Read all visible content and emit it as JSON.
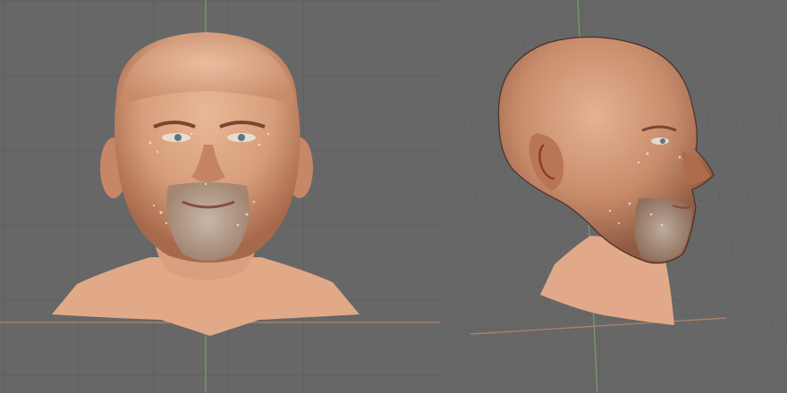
{
  "viewports": [
    {
      "id": "front",
      "view": "front-orthographic",
      "subject": "head-mesh-front"
    },
    {
      "id": "side",
      "view": "side-perspective",
      "subject": "head-mesh-profile"
    }
  ],
  "colors": {
    "background": "#676767",
    "grid_line": "#5a5a5a",
    "grid_major": "#505050",
    "axis_x": "#b5836f",
    "axis_y": "#76a169",
    "skin_light": "#e7b392",
    "skin_mid": "#c98d6d",
    "skin_shadow": "#a06548",
    "beard": "#b7a798"
  }
}
